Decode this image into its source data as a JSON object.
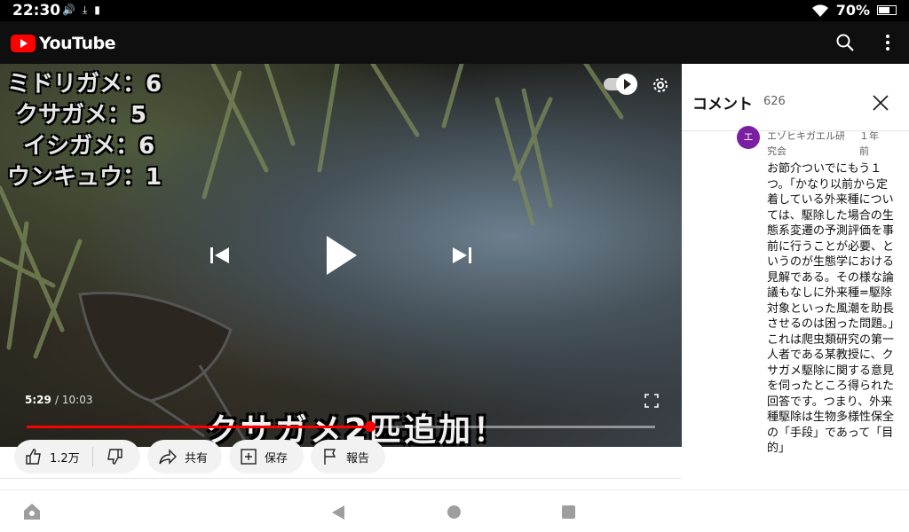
{
  "status": {
    "time": "22:30",
    "battery": "70%",
    "battery_level": 0.7,
    "icons": [
      "volume-icon",
      "download-done-icon",
      "sd-card-icon",
      "wifi-icon",
      "battery-icon"
    ]
  },
  "appbar": {
    "brand": "YouTube",
    "icons": [
      "search-icon",
      "more-vert-icon"
    ]
  },
  "video": {
    "overlay_lines": [
      "ミドリガメ：6",
      " クサガメ：5",
      "  イシガメ：6",
      "ウンキュウ：1"
    ],
    "caption": "クサガメ2匹追加！",
    "current_time": "5:29",
    "duration": "/ 10:03",
    "progress": 0.546,
    "autoplay": true
  },
  "actions": {
    "likes": "1.2万",
    "share": "共有",
    "save": "保存",
    "report": "報告"
  },
  "comments": {
    "title": "コメント",
    "count": "626",
    "item": {
      "avatar_letter": "エ",
      "author": "エゾヒキガエル研究会",
      "time": "１年前",
      "text": "お節介ついでにもう１つ。「かなり以前から定着している外来種については、駆除した場合の生態系変遷の予測評価を事前に行うことが必要、というのが生態学における見解である。その様な論議もなしに外来種=駆除対象といった風潮を助長させるのは困った問題。」これは爬虫類研究の第一人者である某教授に、クサガメ駆除に関する意見を伺ったところ得られた回答です。つまり、外来種駆除は生物多様性保全の「手段」であって「目的」"
    }
  }
}
